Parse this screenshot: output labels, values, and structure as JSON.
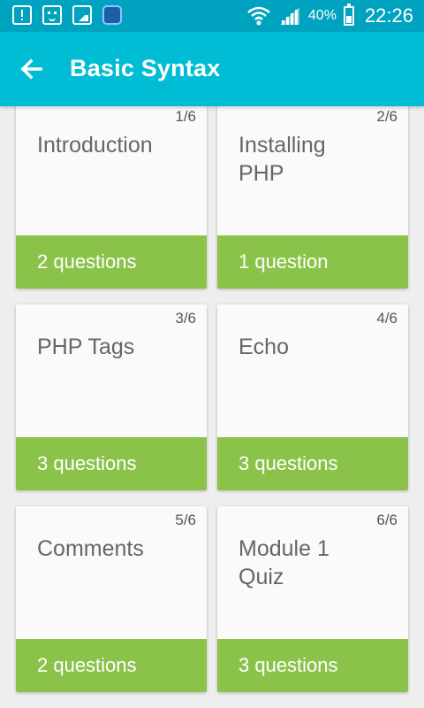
{
  "status_bar": {
    "icons": [
      "notification-icon",
      "emoji-icon",
      "image-icon",
      "app-icon",
      "wifi-icon",
      "signal-icon",
      "battery-icon"
    ],
    "battery_percent": "40%",
    "time": "22:26"
  },
  "app_bar": {
    "back_icon": "arrow-back-icon",
    "title": "Basic Syntax"
  },
  "lessons": [
    {
      "index": "1/6",
      "title": "Introduction",
      "count": "2 questions"
    },
    {
      "index": "2/6",
      "title": "Installing PHP",
      "count": "1 question"
    },
    {
      "index": "3/6",
      "title": "PHP Tags",
      "count": "3 questions"
    },
    {
      "index": "4/6",
      "title": "Echo",
      "count": "3 questions"
    },
    {
      "index": "5/6",
      "title": "Comments",
      "count": "2 questions"
    },
    {
      "index": "6/6",
      "title": "Module 1 Quiz",
      "count": "3 questions"
    }
  ],
  "colors": {
    "status_bar": "#00a3bf",
    "app_bar": "#00bcd4",
    "card_footer": "#8bc34a",
    "background": "#eeeeee"
  }
}
